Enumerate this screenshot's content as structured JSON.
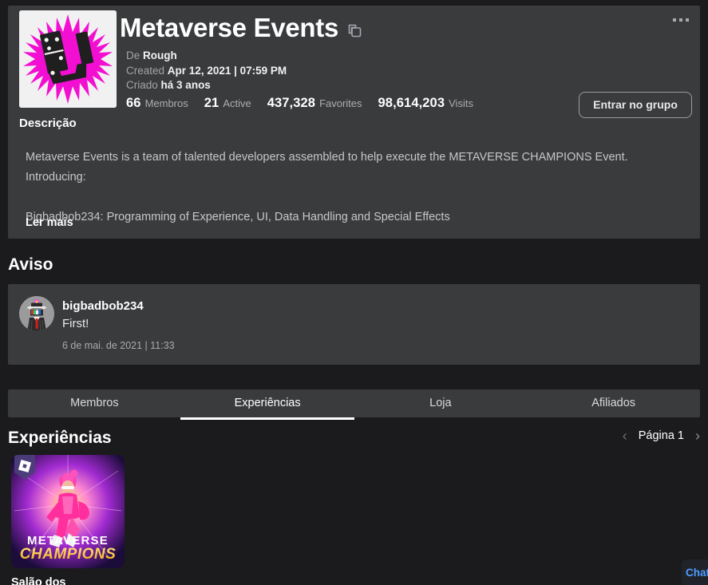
{
  "header": {
    "title": "Metaverse Events",
    "copy_icon": "copy-icon",
    "more_icon": "more-options-icon",
    "owner_label": "De",
    "owner_name": "Rough",
    "created_label": "Created",
    "created_value": "Apr 12, 2021 | 07:59 PM",
    "criado_label": "Criado",
    "criado_value": "há 3 anos",
    "join_button": "Entrar no grupo",
    "stats": [
      {
        "value": "66",
        "label": "Membros"
      },
      {
        "value": "21",
        "label": "Active"
      },
      {
        "value": "437,328",
        "label": "Favorites"
      },
      {
        "value": "98,614,203",
        "label": "Visits"
      }
    ]
  },
  "description": {
    "heading": "Descrição",
    "body": "Metaverse Events is a team of talented developers assembled to help execute the METAVERSE CHAMPIONS Event. Introducing:\n\nBigbadbob234: Programming of Experience, UI, Data Handling and Special Effects",
    "read_more": "Ler mais"
  },
  "announcement": {
    "heading": "Aviso",
    "author": "bigbadbob234",
    "message": "First!",
    "date": "6 de mai. de 2021 | 11:33"
  },
  "tabs": [
    {
      "label": "Membros",
      "active": false
    },
    {
      "label": "Experiências",
      "active": true
    },
    {
      "label": "Loja",
      "active": false
    },
    {
      "label": "Afiliados",
      "active": false
    }
  ],
  "experiences": {
    "heading": "Experiências",
    "pager": {
      "prev_icon": "chevron-left-icon",
      "next_icon": "chevron-right-icon",
      "page_label": "Página 1"
    },
    "items": [
      {
        "name": "Salão dos"
      }
    ]
  },
  "chat": {
    "label": "Chat"
  },
  "colors": {
    "page_background": "#1b1b1d",
    "card_background": "#393b3d",
    "accent_magenta": "#f20fd2",
    "chat_accent": "#4d9dff",
    "muted_text": "#a9aaac"
  }
}
